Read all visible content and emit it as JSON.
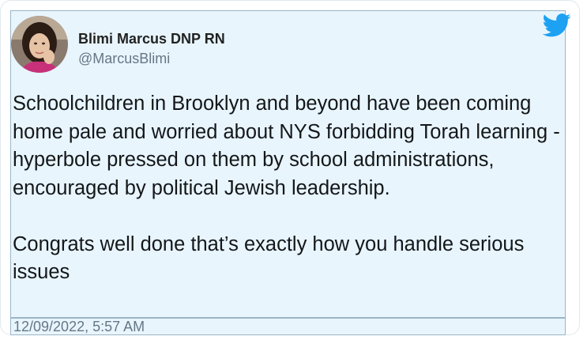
{
  "tweet": {
    "author_name": "Blimi Marcus DNP RN",
    "author_handle": "@MarcusBlimi",
    "paragraphs": [
      "Schoolchildren in Brooklyn and beyond have been coming home pale and worried about NYS forbidding Torah learning - hyperbole pressed on them by school administrations, encouraged by political Jewish leadership.",
      "Congrats well done that’s exactly how you handle serious issues"
    ],
    "timestamp": "12/09/2022, 5:57 AM",
    "icons": {
      "brand": "twitter-bird-icon"
    },
    "colors": {
      "brand_blue": "#1da1f2",
      "highlight_bg": "#e8f5fd",
      "text": "#14171a",
      "secondary_text": "#657786"
    }
  }
}
